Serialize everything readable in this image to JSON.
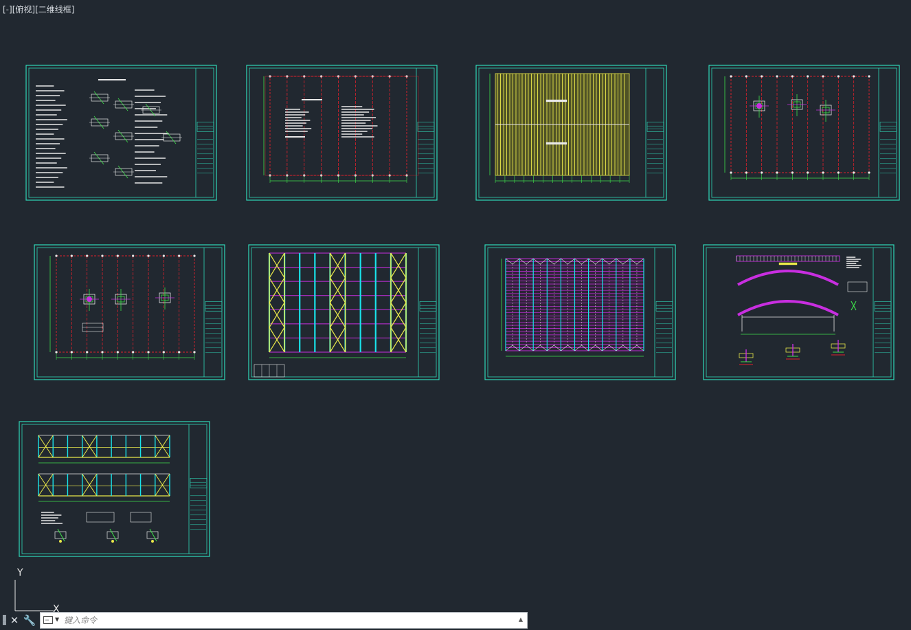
{
  "viewport": {
    "label_parts": [
      "[-]",
      "[俯视]",
      "[二维线框]"
    ],
    "background": "#212830"
  },
  "ucs": {
    "y_label": "Y",
    "x_label": "X"
  },
  "colors": {
    "frame": "#2fd9b9",
    "red_grid": "#e0202c",
    "green": "#3ee04a",
    "yellow": "#e9e84a",
    "cyan": "#19e3ea",
    "magenta": "#c82ee0",
    "white": "#e8e8e8"
  },
  "drawing_sheets": [
    {
      "name": "sheet-design-notes",
      "kind": "notes"
    },
    {
      "name": "sheet-general-notes",
      "kind": "plan-text"
    },
    {
      "name": "sheet-roof-panel-layout",
      "kind": "roof-yellow"
    },
    {
      "name": "sheet-foundation-plan",
      "kind": "grid-details"
    },
    {
      "name": "sheet-anchor-bolt-plan",
      "kind": "grid-details-2"
    },
    {
      "name": "sheet-roof-bracing-plan",
      "kind": "bracing"
    },
    {
      "name": "sheet-purlin-layout",
      "kind": "purlin"
    },
    {
      "name": "sheet-arch-truss-elevation",
      "kind": "arch"
    },
    {
      "name": "sheet-wall-elevations",
      "kind": "elevation"
    }
  ],
  "command_line": {
    "placeholder": "键入命令",
    "close_label": "✕",
    "settings_label": "🔧",
    "history_label": "▲"
  }
}
